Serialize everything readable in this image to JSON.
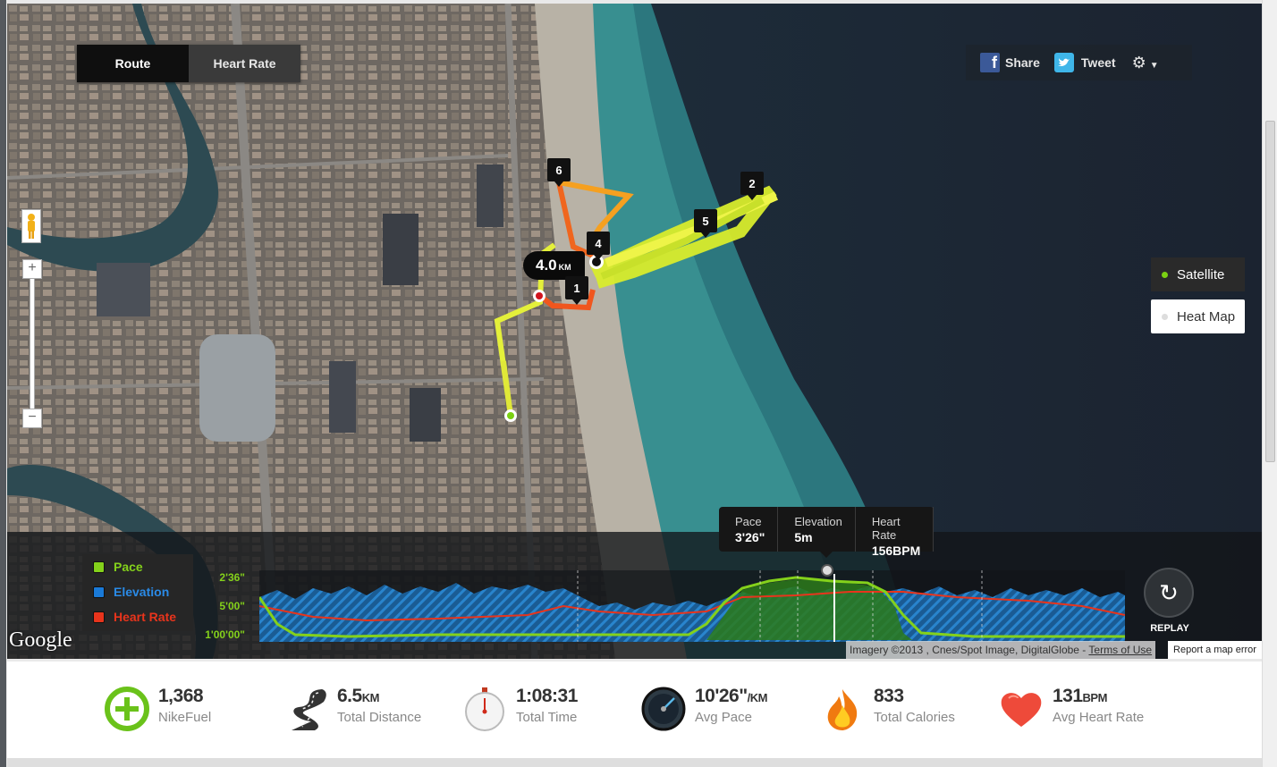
{
  "tabs": {
    "route": "Route",
    "heart_rate": "Heart Rate"
  },
  "share": {
    "facebook_label": "Share",
    "twitter_label": "Tweet"
  },
  "map_layers": {
    "satellite": "Satellite",
    "heat_map": "Heat Map"
  },
  "route_flag": {
    "value": "4.0",
    "unit": "KM"
  },
  "km_markers": [
    "1",
    "2",
    "4",
    "5",
    "6"
  ],
  "tooltip": {
    "pace_label": "Pace",
    "pace_value": "3'26\"",
    "elevation_label": "Elevation",
    "elevation_value": "5m",
    "heart_rate_label": "Heart Rate",
    "heart_rate_value": "156BPM"
  },
  "legend": {
    "pace": "Pace",
    "elevation": "Elevation",
    "heart_rate": "Heart Rate",
    "colors": {
      "pace": "#84d11b",
      "elevation": "#1a7ad8",
      "heart_rate": "#e8341c"
    }
  },
  "y_axis": {
    "top": "2'36\"",
    "mid": "5'00\"",
    "bottom": "1'00'00\""
  },
  "replay_label": "REPLAY",
  "google_logo": "Google",
  "attribution": {
    "text": "Imagery ©2013 , Cnes/Spot Image, DigitalGlobe - ",
    "terms": "Terms of Use"
  },
  "report_error": "Report a map error",
  "stats": [
    {
      "value": "1,368",
      "unit": "",
      "label": "NikeFuel",
      "icon": "nikefuel-icon"
    },
    {
      "value": "6.5",
      "unit": "KM",
      "label": "Total Distance",
      "icon": "road-icon"
    },
    {
      "value": "1:08:31",
      "unit": "",
      "label": "Total Time",
      "icon": "stopwatch-icon"
    },
    {
      "value": "10'26\"",
      "unit": "/KM",
      "label": "Avg Pace",
      "icon": "speedometer-icon"
    },
    {
      "value": "833",
      "unit": "",
      "label": "Total Calories",
      "icon": "flame-icon"
    },
    {
      "value": "131",
      "unit": "BPM",
      "label": "Avg Heart Rate",
      "icon": "heart-icon"
    }
  ]
}
